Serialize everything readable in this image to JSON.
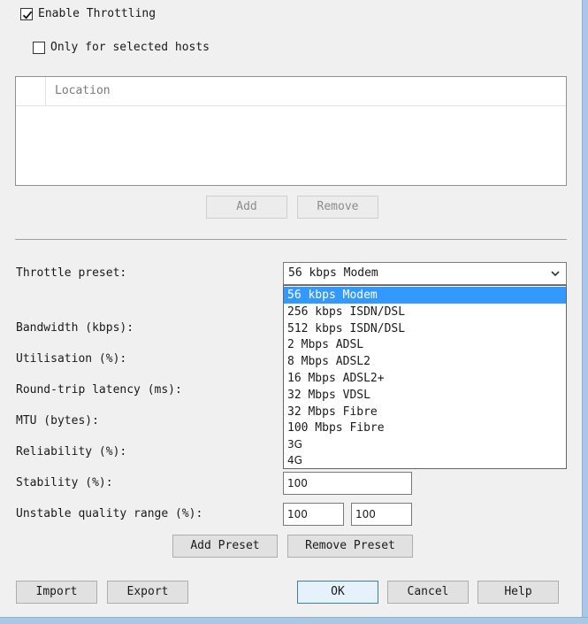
{
  "throttling": {
    "enable_label": "Enable Throttling",
    "enabled": true,
    "only_selected_label": "Only for selected hosts",
    "only_selected": false
  },
  "hosts_table": {
    "column_location": "Location",
    "add_label": "Add",
    "remove_label": "Remove"
  },
  "preset": {
    "label": "Throttle preset:",
    "selected": "56 kbps Modem",
    "options": [
      "56 kbps Modem",
      "256 kbps ISDN/DSL",
      "512 kbps ISDN/DSL",
      "2 Mbps ADSL",
      "8 Mbps ADSL2",
      "16 Mbps ADSL2+",
      "32 Mbps VDSL",
      "32 Mbps Fibre",
      "100 Mbps Fibre",
      "3G",
      "4G"
    ]
  },
  "fields": {
    "bandwidth_label": "Bandwidth (kbps):",
    "utilisation_label": "Utilisation (%):",
    "latency_label": "Round-trip latency (ms):",
    "mtu_label": "MTU (bytes):",
    "reliability_label": "Reliability (%):",
    "stability_label": "Stability (%):",
    "stability_value": "100",
    "unstable_label": "Unstable quality range (%):",
    "unstable_min": "100",
    "unstable_max": "100"
  },
  "preset_buttons": {
    "add": "Add Preset",
    "remove": "Remove Preset"
  },
  "footer": {
    "import": "Import",
    "export": "Export",
    "ok": "OK",
    "cancel": "Cancel",
    "help": "Help"
  },
  "colors": {
    "selection": "#3399ff",
    "frame": "#a9c8e6"
  }
}
